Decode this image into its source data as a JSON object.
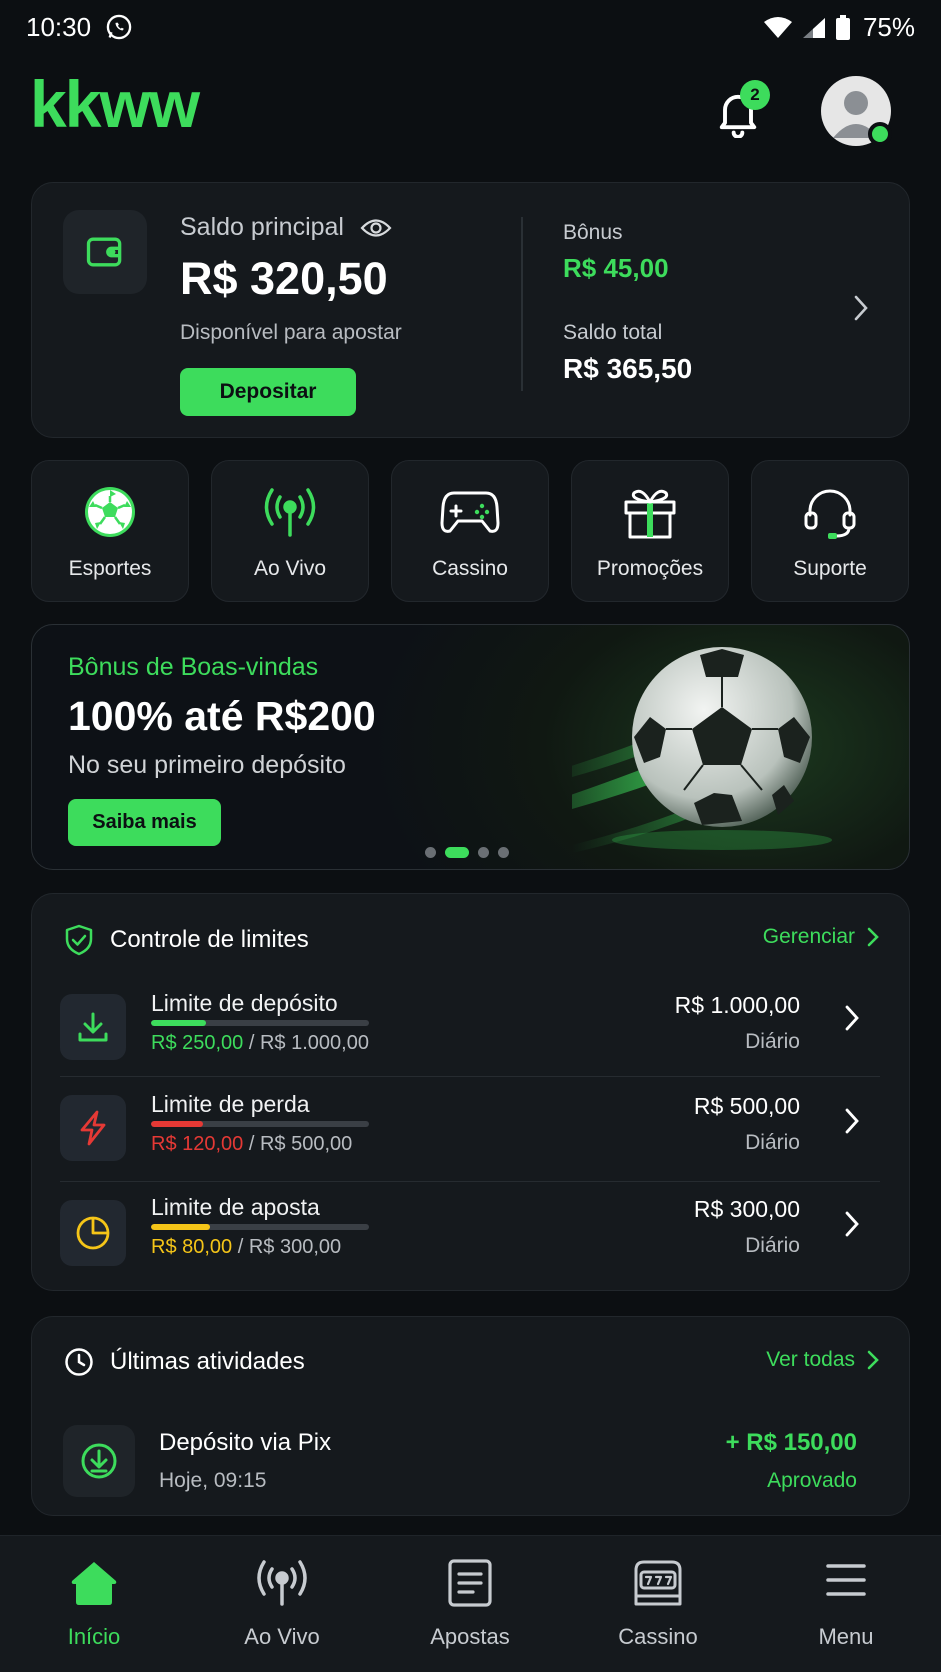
{
  "status_bar": {
    "time": "10:30",
    "battery": "75%"
  },
  "header": {
    "logo": "kkww",
    "notification_count": "2"
  },
  "balance": {
    "label": "Saldo principal",
    "amount": "R$ 320,50",
    "subtitle": "Disponível para apostar",
    "deposit_button": "Depositar",
    "bonus_label": "Bônus",
    "bonus_value": "R$ 45,00",
    "total_label": "Saldo total",
    "total_value": "R$ 365,50"
  },
  "quick_actions": [
    {
      "label": "Esportes",
      "icon": "soccer-ball-icon"
    },
    {
      "label": "Ao Vivo",
      "icon": "live-broadcast-icon"
    },
    {
      "label": "Cassino",
      "icon": "gamepad-icon"
    },
    {
      "label": "Promoções",
      "icon": "gift-icon"
    },
    {
      "label": "Suporte",
      "icon": "headset-icon"
    }
  ],
  "banner": {
    "title": "Bônus de Boas-vindas",
    "headline": "100% até R$200",
    "subtitle": "No seu primeiro depósito",
    "button": "Saiba mais",
    "slide_count": 4,
    "active_slide": 2
  },
  "limits": {
    "title": "Controle de limites",
    "manage_link": "Gerenciar",
    "items": [
      {
        "name": "Limite de depósito",
        "used": "R$ 250,00",
        "limit_text": " / R$ 1.000,00",
        "amount": "R$ 1.000,00",
        "period": "Diário",
        "progress": 0.25,
        "color": "#3ddc5c",
        "icon": "download-icon"
      },
      {
        "name": "Limite de perda",
        "used": "R$ 120,00",
        "limit_text": " / R$ 500,00",
        "amount": "R$ 500,00",
        "period": "Diário",
        "progress": 0.24,
        "color": "#e53935",
        "icon": "lightning-icon"
      },
      {
        "name": "Limite de aposta",
        "used": "R$ 80,00",
        "limit_text": " / R$ 300,00",
        "amount": "R$ 300,00",
        "period": "Diário",
        "progress": 0.27,
        "color": "#f5c518",
        "icon": "pie-chart-icon"
      }
    ]
  },
  "activities": {
    "title": "Últimas atividades",
    "view_all": "Ver todas",
    "items": [
      {
        "name": "Depósito via Pix",
        "time": "Hoje, 09:15",
        "amount": "+ R$ 150,00",
        "status": "Aprovado",
        "icon": "download-circle-icon"
      }
    ]
  },
  "bottom_nav": [
    {
      "label": "Início",
      "icon": "home-icon",
      "active": true
    },
    {
      "label": "Ao Vivo",
      "icon": "live-broadcast-icon",
      "active": false
    },
    {
      "label": "Apostas",
      "icon": "bet-slip-icon",
      "active": false
    },
    {
      "label": "Cassino",
      "icon": "slot-machine-icon",
      "active": false
    },
    {
      "label": "Menu",
      "icon": "menu-icon",
      "active": false
    }
  ],
  "colors": {
    "accent": "#3ddc5c",
    "background": "#0c0f12",
    "card": "#15191d",
    "danger": "#e53935",
    "warning": "#f5c518"
  }
}
